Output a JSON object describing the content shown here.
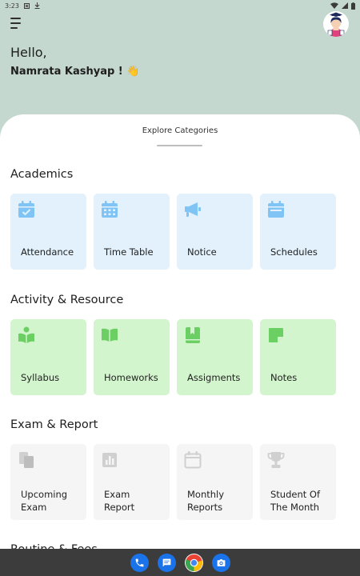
{
  "status_bar": {
    "time": "3:23"
  },
  "header": {
    "hello": "Hello,",
    "name": "Namrata Kashyap ! 👋"
  },
  "sheet": {
    "title": "Explore Categories"
  },
  "sections": {
    "academics": {
      "title": "Academics",
      "items": [
        {
          "label": "Attendance",
          "icon": "calendar-check-icon"
        },
        {
          "label": "Time Table",
          "icon": "calendar-grid-icon"
        },
        {
          "label": "Notice",
          "icon": "megaphone-icon"
        },
        {
          "label": "Schedules",
          "icon": "calendar-icon"
        }
      ]
    },
    "activity": {
      "title": "Activity & Resource",
      "items": [
        {
          "label": "Syllabus",
          "icon": "book-reader-icon"
        },
        {
          "label": "Homeworks",
          "icon": "open-book-icon"
        },
        {
          "label": "Assigments",
          "icon": "bookmark-book-icon"
        },
        {
          "label": "Notes",
          "icon": "sticky-note-icon"
        }
      ]
    },
    "exam": {
      "title": "Exam & Report",
      "items": [
        {
          "label": "Upcoming\nExam",
          "icon": "copy-docs-icon"
        },
        {
          "label": "Exam\nReport",
          "icon": "bar-chart-icon"
        },
        {
          "label": "Monthly\nReports",
          "icon": "calendar-blank-icon"
        },
        {
          "label": "Student Of\nThe Month",
          "icon": "trophy-icon"
        }
      ]
    },
    "partial": {
      "title": "Routine & Fees"
    }
  },
  "colors": {
    "header_bg": "#c5d8d0",
    "academics_card": "#e2f1fc",
    "academics_icon": "#7fc4f4",
    "activity_card": "#d3f5cd",
    "activity_icon": "#6ccf63",
    "exam_card": "#f5f5f5",
    "exam_icon": "#d0d0d0",
    "navbar": "#3c3c3c"
  },
  "navbar": {
    "apps": [
      "phone-icon",
      "messages-icon",
      "chrome-icon",
      "camera-icon"
    ]
  }
}
